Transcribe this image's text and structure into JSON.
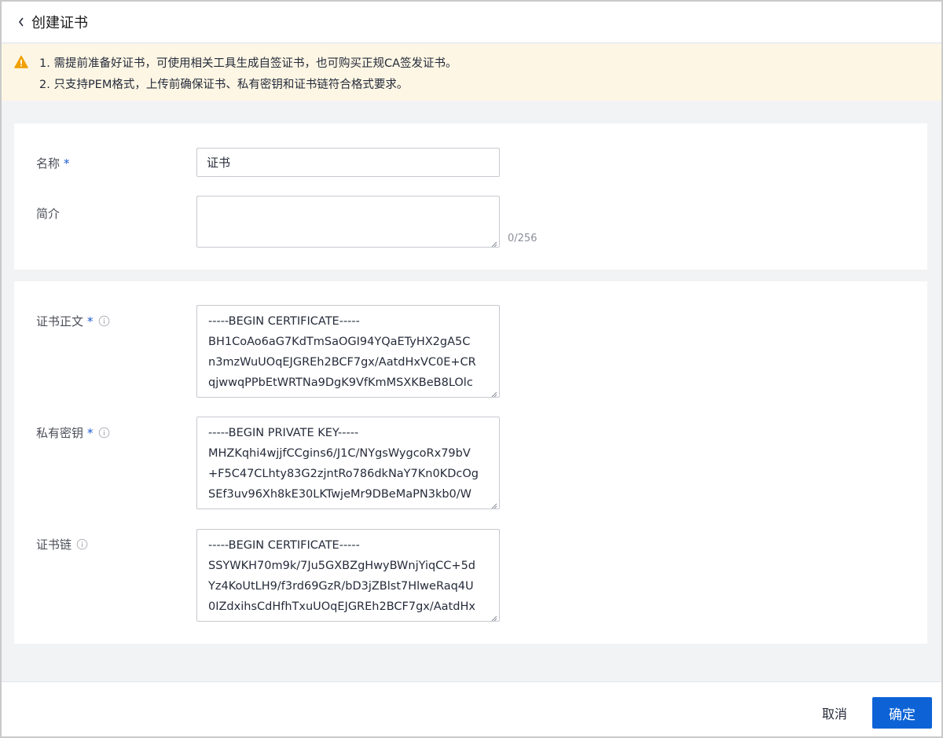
{
  "header": {
    "back_icon": "chevron-left-icon",
    "title": "创建证书"
  },
  "notice": {
    "icon": "warning-icon",
    "accent_color": "#f0a000",
    "background": "#fdf6e4",
    "lines": [
      "1. 需提前准备好证书，可使用相关工具生成自签证书，也可购买正规CA签发证书。",
      "2. 只支持PEM格式，上传前确保证书、私有密钥和证书链符合格式要求。"
    ]
  },
  "form": {
    "name": {
      "label": "名称",
      "required_mark": "*",
      "value": "证书"
    },
    "description": {
      "label": "简介",
      "value": "",
      "counter": "0/256"
    },
    "certificate_body": {
      "label": "证书正文",
      "required_mark": "*",
      "info_icon": "info-icon",
      "lines": [
        "-----BEGIN CERTIFICATE-----",
        "BH1CoAo6aG7KdTmSaOGI94YQaETyHX2gA5C",
        "n3mzWuUOqEJGREh2BCF7gx/AatdHxVC0E+CR",
        "qjwwqPPbEtWRTNa9DgK9VfKmMSXKBeB8LOlc"
      ]
    },
    "private_key": {
      "label": "私有密钥",
      "required_mark": "*",
      "info_icon": "info-icon",
      "lines": [
        "-----BEGIN PRIVATE KEY-----",
        "MHZKqhi4wjjfCCgins6/J1C/NYgsWygcoRx79bV",
        "+F5C47CLhty83G2zjntRo786dkNaY7Kn0KDcOg",
        "SEf3uv96Xh8kE30LKTwjeMr9DBeMaPN3kb0/W"
      ]
    },
    "certificate_chain": {
      "label": "证书链",
      "info_icon": "info-icon",
      "lines": [
        "-----BEGIN CERTIFICATE-----",
        "SSYWKH70m9k/7Ju5GXBZgHwyBWnjYiqCC+5d",
        "Yz4KoUtLH9/f3rd69GzR/bD3jZBlst7HlweRaq4U",
        "0IZdxihsCdHfhTxuUOqEJGREh2BCF7gx/AatdHx"
      ]
    }
  },
  "footer": {
    "cancel_label": "取消",
    "ok_label": "确定",
    "primary_color": "#0d63d6"
  }
}
